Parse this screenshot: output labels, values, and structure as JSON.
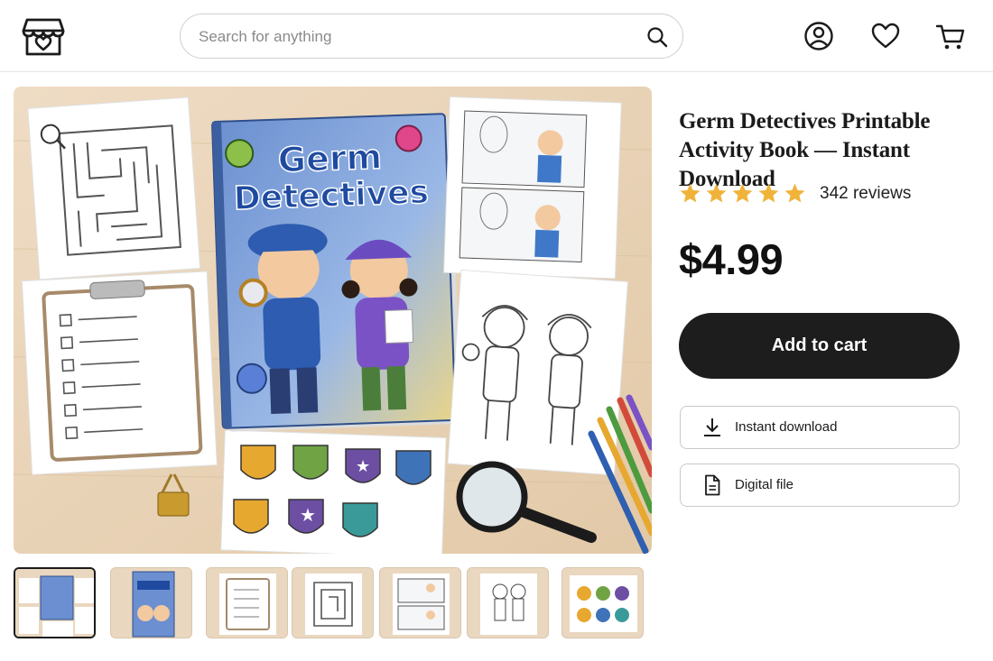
{
  "header": {
    "logo_icon": "shop-heart-icon",
    "search": {
      "placeholder": "Search for anything",
      "value": ""
    },
    "icons": [
      "account-icon",
      "favorites-heart-icon",
      "cart-icon"
    ]
  },
  "gallery": {
    "main_image_alt": "Germ Detectives activity book flat lay",
    "book_title_line1": "Germ",
    "book_title_line2": "Detectives",
    "thumb_count": 7,
    "active_thumb": 0
  },
  "product": {
    "title": "Germ Detectives Printable Activity Book — Instant Download",
    "rating": 5,
    "reviews_label": "342 reviews",
    "price": "$4.99",
    "add_to_cart_label": "Add to cart",
    "options": [
      {
        "label": "Instant download",
        "icon": "download-icon"
      },
      {
        "label": "Digital file",
        "icon": "document-icon"
      }
    ]
  },
  "colors": {
    "star": "#f0b33a",
    "button_bg": "#1d1d1d",
    "table": "#ead7bf"
  }
}
